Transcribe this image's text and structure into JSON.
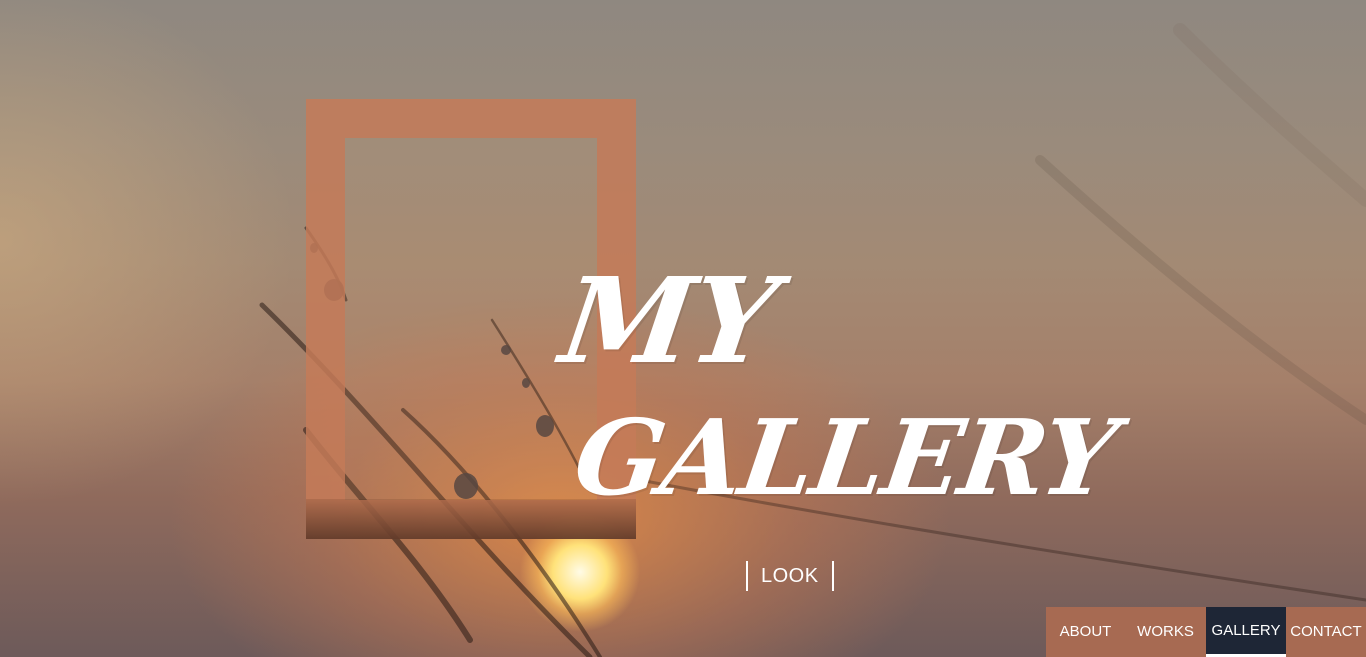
{
  "hero": {
    "title_line1": "MY",
    "title_line2": "GALLERY",
    "look_label": "LOOK"
  },
  "nav": {
    "items": [
      {
        "label": "ABOUT",
        "active": false
      },
      {
        "label": "WORKS",
        "active": false
      },
      {
        "label": "GALLERY",
        "active": true
      },
      {
        "label": "CONTACT",
        "active": false
      }
    ]
  },
  "colors": {
    "nav_background": "#a76a52",
    "nav_active": "#1e2636",
    "frame": "#c47a58",
    "text": "#ffffff"
  }
}
